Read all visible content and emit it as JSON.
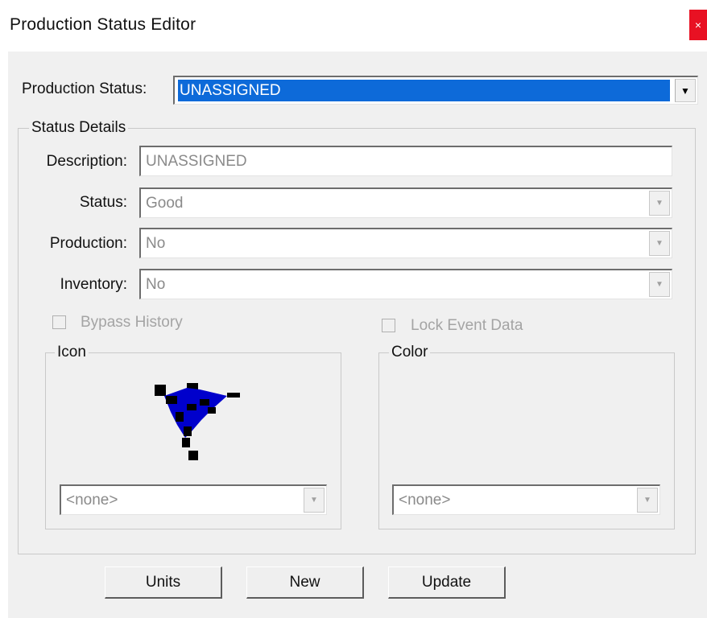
{
  "window": {
    "title": "Production Status Editor",
    "close_glyph": "×"
  },
  "production_status": {
    "label": "Production Status:",
    "value": "UNASSIGNED"
  },
  "status_details": {
    "group_label": "Status Details",
    "description": {
      "label": "Description:",
      "value": "UNASSIGNED"
    },
    "status": {
      "label": "Status:",
      "value": "Good"
    },
    "production": {
      "label": "Production:",
      "value": "No"
    },
    "inventory": {
      "label": "Inventory:",
      "value": "No"
    },
    "bypass_history": {
      "label": "Bypass History",
      "checked": false
    },
    "lock_event_data": {
      "label": "Lock Event Data",
      "checked": false
    },
    "icon": {
      "group_label": "Icon",
      "icon_name": "flag-icon",
      "select_value": "<none>",
      "accent": "#0000cc"
    },
    "color": {
      "group_label": "Color",
      "select_value": "<none>"
    }
  },
  "buttons": {
    "units": "Units",
    "new": "New",
    "update": "Update"
  },
  "colors": {
    "selection": "#0d6ad9",
    "close": "#e81123",
    "dialog_bg": "#f0f0f0"
  }
}
